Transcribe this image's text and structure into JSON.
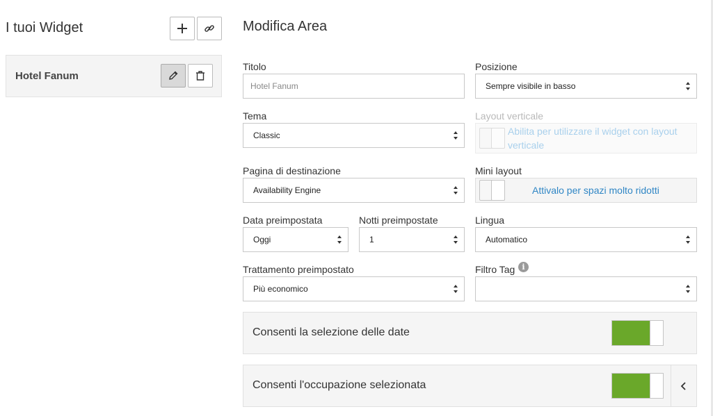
{
  "left_panel": {
    "title": "I tuoi Widget",
    "add_icon": "plus-icon",
    "link_icon": "link-icon",
    "widgets": [
      {
        "name": "Hotel Fanum",
        "edit_icon": "pencil-icon",
        "delete_icon": "trash-icon"
      }
    ]
  },
  "form": {
    "title": "Modifica Area",
    "titolo": {
      "label": "Titolo",
      "placeholder": "Hotel Fanum"
    },
    "posizione": {
      "label": "Posizione",
      "value": "Sempre visibile in basso"
    },
    "tema": {
      "label": "Tema",
      "value": "Classic"
    },
    "layout_verticale": {
      "label": "Layout verticale",
      "text": "Abilita per utilizzare il widget con layout verticale",
      "enabled": false
    },
    "pagina_destinazione": {
      "label": "Pagina di destinazione",
      "value": "Availability Engine"
    },
    "mini_layout": {
      "label": "Mini layout",
      "text": "Attivalo per spazi molto ridotti",
      "enabled": false
    },
    "data_preimpostata": {
      "label": "Data preimpostata",
      "value": "Oggi"
    },
    "notti_preimpostate": {
      "label": "Notti preimpostate",
      "value": "1"
    },
    "lingua": {
      "label": "Lingua",
      "value": "Automatico"
    },
    "trattamento": {
      "label": "Trattamento preimpostato",
      "value": "Più economico"
    },
    "filtro_tag": {
      "label": "Filtro Tag",
      "value": "",
      "info_icon": "info-icon"
    },
    "options": [
      {
        "label": "Consenti la selezione delle date",
        "enabled": true
      },
      {
        "label": "Consenti l'occupazione selezionata",
        "enabled": true,
        "expand_icon": "chevron-left-icon"
      }
    ]
  },
  "colors": {
    "switch_on": "#6aa82a",
    "link_blue": "#2f86c5"
  }
}
